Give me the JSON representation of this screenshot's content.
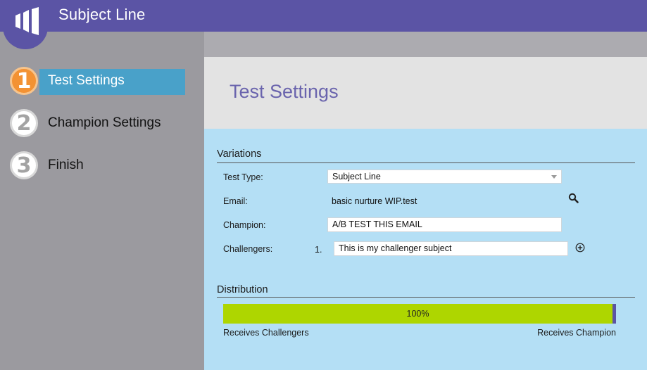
{
  "header": {
    "title": "Subject Line",
    "logo_icon": "marketo-logo-icon",
    "brand_color": "#5b54a5"
  },
  "sidebar": {
    "steps": [
      {
        "number": "1",
        "label": "Test Settings",
        "active": true
      },
      {
        "number": "2",
        "label": "Champion Settings",
        "active": false
      },
      {
        "number": "3",
        "label": "Finish",
        "active": false
      }
    ],
    "active_color": "#49a1c9",
    "active_badge_color": "#f39233"
  },
  "main": {
    "title": "Test Settings",
    "variations": {
      "section_title": "Variations",
      "test_type": {
        "label": "Test Type:",
        "value": "Subject Line"
      },
      "email": {
        "label": "Email:",
        "value": "basic nurture WIP.test",
        "icon": "search-icon"
      },
      "champion": {
        "label": "Champion:",
        "value": "A/B TEST THIS EMAIL"
      },
      "challengers": {
        "label": "Challengers:",
        "items": [
          {
            "number": "1.",
            "value": "This is my challenger subject"
          }
        ],
        "add_icon": "plus-circle-icon"
      }
    },
    "distribution": {
      "section_title": "Distribution",
      "percent_label": "100%",
      "challenger_share": 1.0,
      "left_label": "Receives Challengers",
      "right_label": "Receives Champion",
      "bar_color": "#aed600"
    }
  }
}
